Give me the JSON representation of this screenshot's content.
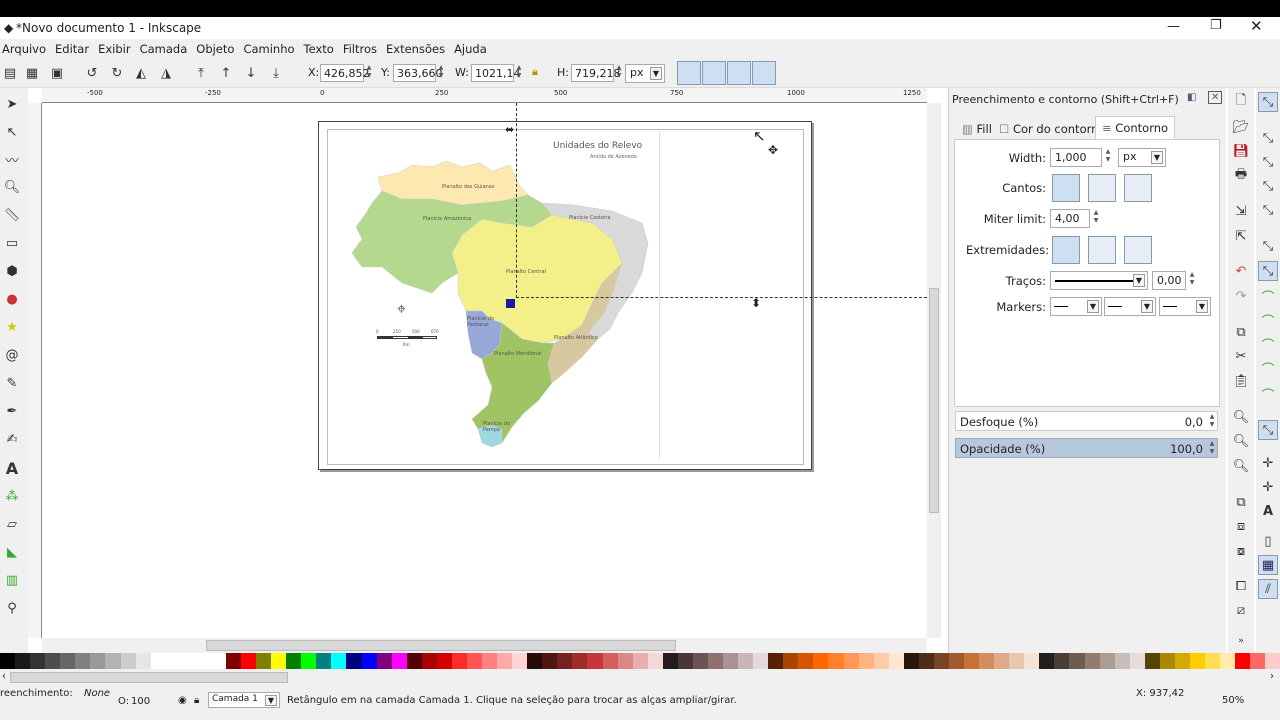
{
  "window": {
    "title": "*Novo documento 1 - Inkscape"
  },
  "menu": [
    "Arquivo",
    "Editar",
    "Exibir",
    "Camada",
    "Objeto",
    "Caminho",
    "Texto",
    "Filtros",
    "Extensões",
    "Ajuda"
  ],
  "toolbar": {
    "x_label": "X:",
    "x_value": "426,852",
    "y_label": "Y:",
    "y_value": "363,660",
    "w_label": "W:",
    "w_value": "1021,14",
    "h_label": "H:",
    "h_value": "719,218",
    "unit": "px"
  },
  "ruler": {
    "ticks": [
      "-500",
      "-250",
      "0",
      "250",
      "500",
      "750",
      "1000",
      "1250"
    ]
  },
  "map": {
    "title": "Unidades do Relevo",
    "subtitle": "Aroldo de Azevedo",
    "regions": [
      "Planalto das Guianas",
      "Planície Amazônica",
      "Planície Costeira",
      "Planalto Central",
      "Planalto Atlântico",
      "Planície do Pantanal",
      "Planalto Meridional",
      "Planície do Pampa"
    ],
    "scale_labels": [
      "0",
      "250",
      "500",
      "670"
    ],
    "scale_unit": "Km"
  },
  "panel": {
    "title": "Preenchimento e contorno (Shift+Ctrl+F)",
    "tabs": [
      "Fill",
      "Cor do contorno",
      "Contorno"
    ],
    "width_label": "Width:",
    "width_value": "1,000",
    "width_unit": "px",
    "cantos_label": "Cantos:",
    "miter_label": "Miter limit:",
    "miter_value": "4,00",
    "extremidades_label": "Extremidades:",
    "tracos_label": "Traços:",
    "tracos_value": "0,00",
    "markers_label": "Markers:",
    "desfoque_label": "Desfoque (%)",
    "desfoque_value": "0,0",
    "opacidade_label": "Opacidade (%)",
    "opacidade_value": "100,0"
  },
  "status": {
    "fill_label": "reenchimento:",
    "fill_value": "None",
    "opacity_label": "O:",
    "opacity_value": "100",
    "layer": "Camada 1",
    "message": "Retângulo em na camada Camada 1. Clique na seleção para trocar as alças ampliar/girar.",
    "coords": "X: 937,42",
    "zoom": "50%"
  },
  "palette_colors": [
    "#000000",
    "#1a1a1a",
    "#333333",
    "#4d4d4d",
    "#666666",
    "#808080",
    "#999999",
    "#b3b3b3",
    "#cccccc",
    "#e6e6e6",
    "#ffffff",
    "#ffffff",
    "#ffffff",
    "#ffffff",
    "#ffffff",
    "#800000",
    "#ff0000",
    "#808000",
    "#ffff00",
    "#008000",
    "#00ff00",
    "#008080",
    "#00ffff",
    "#000080",
    "#0000ff",
    "#800080",
    "#ff00ff",
    "#550000",
    "#aa0000",
    "#d40000",
    "#ff2a2a",
    "#ff5555",
    "#ff8080",
    "#ffaaaa",
    "#ffd5d5",
    "#280b0b",
    "#501616",
    "#782121",
    "#a02c2c",
    "#c83737",
    "#d35f5f",
    "#de8787",
    "#e9afaf",
    "#f4d7d7",
    "#241c1c",
    "#483737",
    "#6c5353",
    "#916f6f",
    "#ac9393",
    "#c8b7b7",
    "#e3dbdb",
    "#552200",
    "#aa4400",
    "#d45500",
    "#ff6600",
    "#ff7f2a",
    "#ff9955",
    "#ffb380",
    "#ffccaa",
    "#ffe6d5",
    "#28170b",
    "#502d16",
    "#784421",
    "#a05a2c",
    "#c87137",
    "#d38d5f",
    "#deaa87",
    "#e9c6af",
    "#f4e3d7",
    "#241f1c",
    "#483e37",
    "#6c5d53",
    "#917c6f",
    "#ac9d93",
    "#c8beb7",
    "#e3dedb",
    "#554400",
    "#aa8800",
    "#d4aa00",
    "#ffcc00",
    "#ffdd55",
    "#ffeeaa",
    "#ff0000",
    "#ff6666",
    "#ffcccc"
  ]
}
